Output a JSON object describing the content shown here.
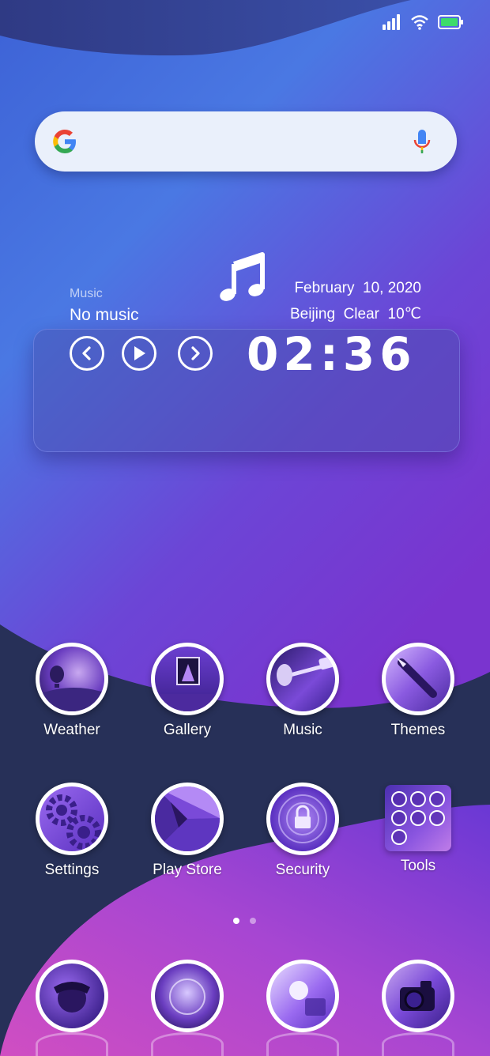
{
  "status_bar": {
    "signal_icon": "signal-bars-icon",
    "wifi_icon": "wifi-icon",
    "battery_icon": "battery-icon",
    "battery_color": "#3ddc6a"
  },
  "search": {
    "logo_icon": "google-g-icon",
    "mic_icon": "mic-icon",
    "placeholder": ""
  },
  "music_widget": {
    "label": "Music",
    "track": "No music",
    "date": "February  10, 2020",
    "weather": "Beijing  Clear  10℃",
    "time": "02:36",
    "controls": [
      "previous-icon",
      "play-icon",
      "next-icon"
    ]
  },
  "apps": [
    {
      "label": "Weather"
    },
    {
      "label": "Gallery"
    },
    {
      "label": "Music"
    },
    {
      "label": "Themes"
    },
    {
      "label": "Settings"
    },
    {
      "label": "Play Store"
    },
    {
      "label": "Security"
    },
    {
      "label": "Tools"
    }
  ],
  "dock": [
    "phone-icon",
    "browser-icon",
    "messages-icon",
    "camera-icon"
  ],
  "page_indicator": {
    "count": 2,
    "active": 1
  },
  "colors": {
    "background_dark": "#273058",
    "wave_blue": "#4a78e0",
    "wave_purple": "#7b35d0",
    "wave_magenta": "#c84fc0"
  }
}
